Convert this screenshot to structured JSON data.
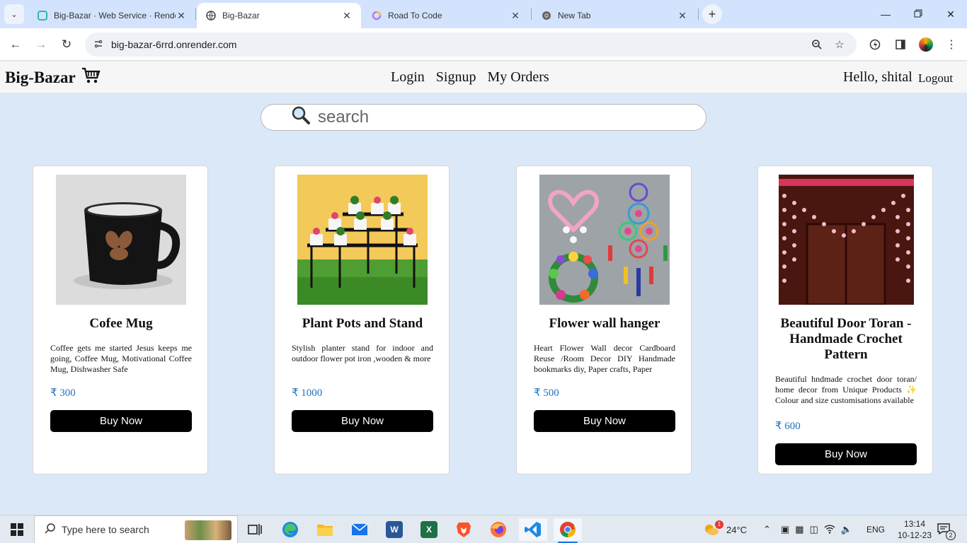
{
  "browser": {
    "tabs": [
      {
        "title": "Big-Bazar · Web Service · Render",
        "favicon": "render-favicon-icon",
        "active": false
      },
      {
        "title": "Big-Bazar",
        "favicon": "globe-icon",
        "active": true
      },
      {
        "title": "Road To Code",
        "favicon": "ring-icon",
        "active": false
      },
      {
        "title": "New Tab",
        "favicon": "chrome-icon",
        "active": false
      }
    ],
    "url": "big-bazar-6rrd.onrender.com"
  },
  "site": {
    "brand": "Big-Bazar",
    "nav": {
      "login": "Login",
      "signup": "Signup",
      "orders": "My Orders"
    },
    "greeting": "Hello, shital",
    "logout": "Logout",
    "search_placeholder": "search"
  },
  "products": [
    {
      "name": "Cofee Mug",
      "description": "Coffee gets me started Jesus keeps me going, Coffee Mug, Motivational Coffee Mug, Dishwasher Safe",
      "price": "₹ 300",
      "buy": "Buy Now"
    },
    {
      "name": "Plant Pots and Stand",
      "description": "Stylish planter stand for indoor and outdoor flower pot iron ,wooden & more",
      "price": "₹ 1000",
      "buy": "Buy Now"
    },
    {
      "name": "Flower wall hanger",
      "description": "Heart Flower Wall decor Cardboard Reuse /Room Decor DIY Handmade bookmarks diy, Paper crafts, Paper",
      "price": "₹ 500",
      "buy": "Buy Now"
    },
    {
      "name": "Beautiful Door Toran - Handmade Crochet Pattern",
      "description": "Beautiful hndmade crochet door toran/ home decor from Unique Products ✨ Colour and size customisations available",
      "price": "₹ 600",
      "buy": "Buy Now"
    }
  ],
  "taskbar": {
    "search_placeholder": "Type here to search",
    "weather": "24°C",
    "weather_badge": "1",
    "language": "ENG",
    "time": "13:14",
    "date": "10-12-23",
    "notifications": "2"
  }
}
